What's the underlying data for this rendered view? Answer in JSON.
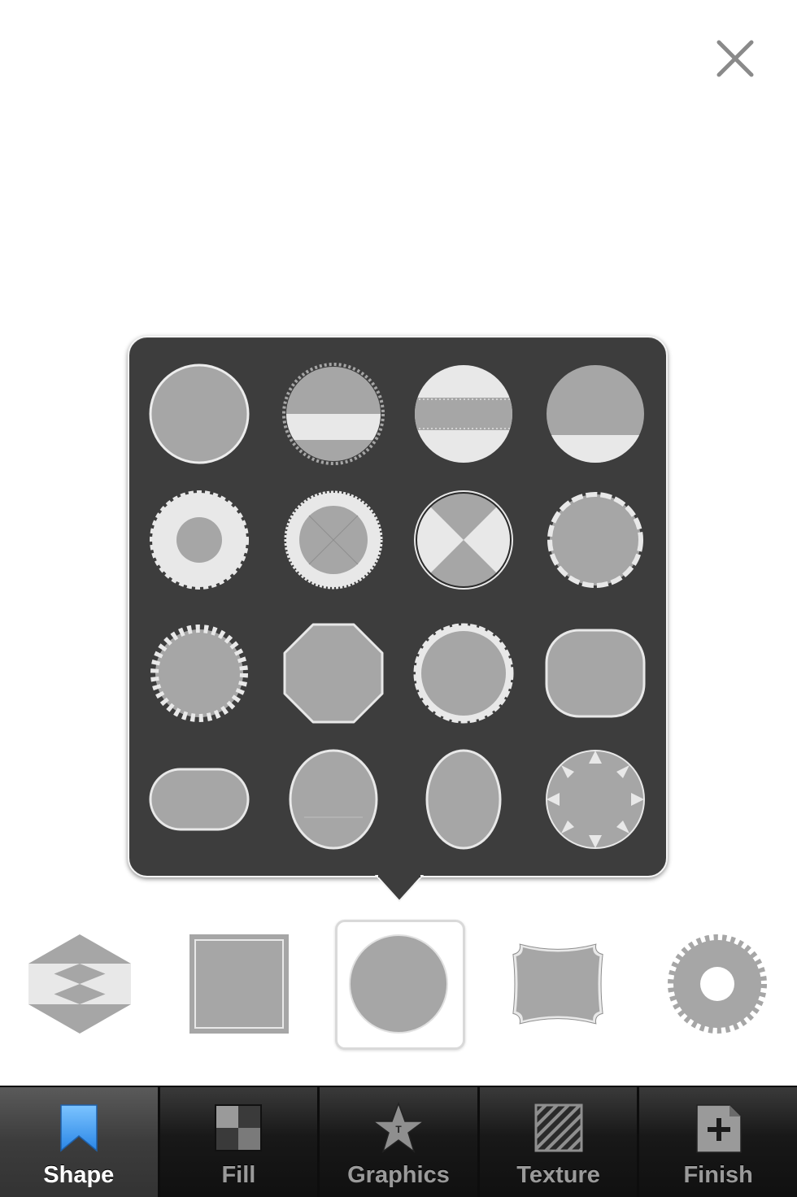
{
  "colors": {
    "accent": "#3b9cf2",
    "popover_bg": "#3d3d3d",
    "shape_fill": "#a6a6a6",
    "shape_light": "#e6e6e6",
    "tab_active_label": "#ffffff",
    "tab_inactive_label": "#9a9a9a"
  },
  "close": {
    "icon": "close-icon"
  },
  "shape_picker": {
    "shapes": [
      "circle-plain",
      "circle-scalloped-banded",
      "circle-banded",
      "circle-half",
      "flower-ring",
      "seal-ring-cross",
      "circle-quartered",
      "wavy-badge",
      "starburst",
      "rounded-octagon",
      "scalloped-circle",
      "rounded-square",
      "pill",
      "tall-oval-line",
      "oval",
      "notched-circle"
    ]
  },
  "bottom_shapes": {
    "items": [
      "diamond-banded",
      "square-framed",
      "circle",
      "ornate-frame",
      "sunburst-ring"
    ],
    "selected": "circle"
  },
  "tabs": [
    {
      "label": "Shape",
      "icon": "bookmark-icon",
      "active": true
    },
    {
      "label": "Fill",
      "icon": "checker-icon",
      "active": false
    },
    {
      "label": "Graphics",
      "icon": "star-icon",
      "active": false
    },
    {
      "label": "Texture",
      "icon": "stripes-icon",
      "active": false
    },
    {
      "label": "Finish",
      "icon": "add-page-icon",
      "active": false
    }
  ]
}
